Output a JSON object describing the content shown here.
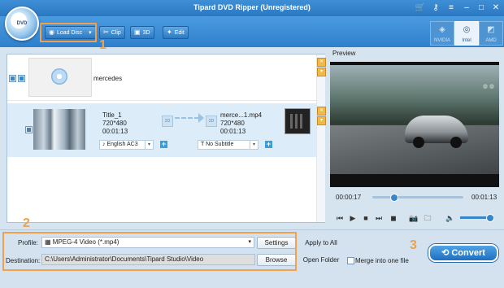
{
  "window": {
    "title": "Tipard DVD Ripper (Unregistered)"
  },
  "logo": {
    "label": "DVD"
  },
  "toolbar": {
    "load_disc": "Load Disc",
    "clip": "Clip",
    "three_d": "3D",
    "edit": "Edit",
    "gpu": [
      "NVIDIA",
      "Intel",
      "AMD"
    ]
  },
  "annotations": {
    "one": "1",
    "two": "2",
    "three": "3"
  },
  "list": {
    "disc_name": "mercedes",
    "title": {
      "name": "Title_1",
      "resolution": "720*480",
      "duration": "00:01:13",
      "output_name": "merce...1.mp4",
      "output_resolution": "720*480",
      "output_duration": "00:01:13",
      "audio": "English AC3",
      "subtitle": "No Subtitle",
      "in_badge": "2D",
      "out_badge": "2D"
    }
  },
  "preview": {
    "label": "Preview",
    "current_time": "00:00:17",
    "total_time": "00:01:13",
    "progress": 0.23,
    "volume": 0.85
  },
  "bottom": {
    "profile_label": "Profile:",
    "profile_value": "MPEG-4 Video (*.mp4)",
    "settings": "Settings",
    "apply_all": "Apply to All",
    "destination_label": "Destination:",
    "destination_value": "C:\\Users\\Administrator\\Documents\\Tipard Studio\\Video",
    "browse": "Browse",
    "open_folder": "Open Folder",
    "merge": "Merge into one file",
    "convert": "Convert"
  },
  "colors": {
    "accent": "#2b78c2",
    "highlight": "#f0a14a"
  }
}
